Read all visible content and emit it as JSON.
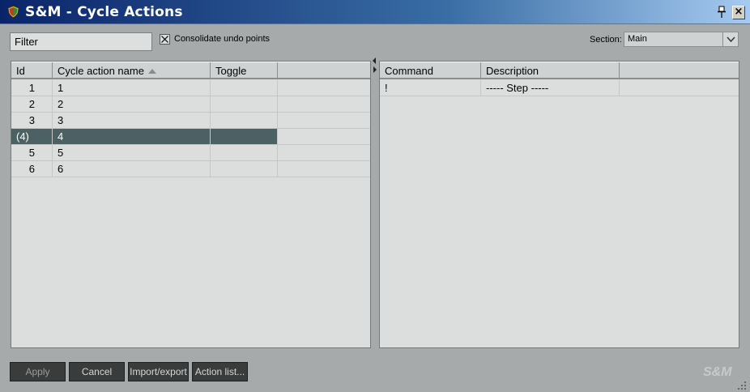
{
  "window": {
    "title": "S&M - Cycle Actions",
    "close_label": "×"
  },
  "toolbar": {
    "filter_value": "Filter",
    "consolidate_label": "Consolidate undo points",
    "consolidate_checked": true,
    "section_label": "Section:",
    "section_value": "Main"
  },
  "actions_table": {
    "columns": [
      "Id",
      "Cycle action name",
      "Toggle"
    ],
    "sort_column": "Cycle action name",
    "rows": [
      {
        "id": "1",
        "name": "1",
        "toggle": ""
      },
      {
        "id": "2",
        "name": "2",
        "toggle": ""
      },
      {
        "id": "3",
        "name": "3",
        "toggle": ""
      },
      {
        "id": "(4)",
        "name": "4",
        "toggle": "",
        "selected": true
      },
      {
        "id": "5",
        "name": "5",
        "toggle": ""
      },
      {
        "id": "6",
        "name": "6",
        "toggle": ""
      }
    ]
  },
  "commands_table": {
    "columns": [
      "Command",
      "Description"
    ],
    "rows": [
      {
        "command": "!",
        "description": "----- Step -----"
      }
    ]
  },
  "buttons": {
    "apply": "Apply",
    "cancel": "Cancel",
    "import_export": "Import/export",
    "action_list": "Action list..."
  },
  "branding": {
    "logo": "S&M"
  },
  "colors": {
    "selection": "#4b6163",
    "button_bg": "#3a3c3c",
    "panel_bg": "#dcdede"
  }
}
